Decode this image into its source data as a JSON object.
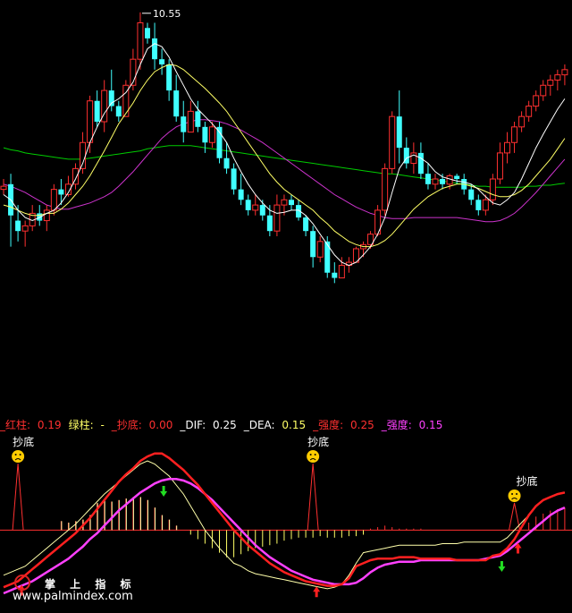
{
  "chart_data": [
    {
      "type": "candlestick",
      "title": "",
      "peak_label": "10.55",
      "x": [
        1,
        2,
        3,
        4,
        5,
        6,
        7,
        8,
        9,
        10,
        11,
        12,
        13,
        14,
        15,
        16,
        17,
        18,
        19,
        20,
        21,
        22,
        23,
        24,
        25,
        26,
        27,
        28,
        29,
        30,
        31,
        32,
        33,
        34,
        35,
        36,
        37,
        38,
        39,
        40,
        41,
        42,
        43,
        44,
        45,
        46,
        47,
        48,
        49,
        50,
        51,
        52,
        53,
        54,
        55,
        56,
        57,
        58,
        59,
        60,
        61,
        62,
        63,
        64,
        65,
        66,
        67,
        68,
        69,
        70,
        71,
        72,
        73,
        74,
        75,
        76,
        77,
        78,
        79
      ],
      "ohlc": [
        [
          8.85,
          8.95,
          8.8,
          8.88
        ],
        [
          8.9,
          9.0,
          8.3,
          8.6
        ],
        [
          8.55,
          8.7,
          8.35,
          8.45
        ],
        [
          8.45,
          8.55,
          8.3,
          8.5
        ],
        [
          8.5,
          8.7,
          8.45,
          8.62
        ],
        [
          8.62,
          8.7,
          8.5,
          8.55
        ],
        [
          8.55,
          8.7,
          8.45,
          8.65
        ],
        [
          8.65,
          8.9,
          8.6,
          8.85
        ],
        [
          8.85,
          8.95,
          8.7,
          8.8
        ],
        [
          8.8,
          8.98,
          8.78,
          8.9
        ],
        [
          8.9,
          9.1,
          8.85,
          9.05
        ],
        [
          9.05,
          9.4,
          9.0,
          9.3
        ],
        [
          9.3,
          9.75,
          9.2,
          9.7
        ],
        [
          9.7,
          9.8,
          9.45,
          9.5
        ],
        [
          9.5,
          9.9,
          9.4,
          9.8
        ],
        [
          9.8,
          10.0,
          9.6,
          9.65
        ],
        [
          9.65,
          9.7,
          9.5,
          9.55
        ],
        [
          9.55,
          9.9,
          9.55,
          9.85
        ],
        [
          9.85,
          10.2,
          9.8,
          10.1
        ],
        [
          10.1,
          10.55,
          10.0,
          10.45
        ],
        [
          10.4,
          10.45,
          10.25,
          10.3
        ],
        [
          10.3,
          10.45,
          10.0,
          10.1
        ],
        [
          10.1,
          10.2,
          9.95,
          10.05
        ],
        [
          10.05,
          10.1,
          9.7,
          9.8
        ],
        [
          9.8,
          9.95,
          9.5,
          9.55
        ],
        [
          9.55,
          9.7,
          9.3,
          9.4
        ],
        [
          9.4,
          9.7,
          9.4,
          9.6
        ],
        [
          9.6,
          9.7,
          9.4,
          9.45
        ],
        [
          9.45,
          9.5,
          9.2,
          9.3
        ],
        [
          9.3,
          9.5,
          9.25,
          9.45
        ],
        [
          9.45,
          9.5,
          9.1,
          9.15
        ],
        [
          9.15,
          9.3,
          9.0,
          9.05
        ],
        [
          9.05,
          9.1,
          8.8,
          8.85
        ],
        [
          8.85,
          9.0,
          8.7,
          8.75
        ],
        [
          8.75,
          8.8,
          8.6,
          8.65
        ],
        [
          8.65,
          8.8,
          8.6,
          8.7
        ],
        [
          8.7,
          8.75,
          8.55,
          8.6
        ],
        [
          8.6,
          8.7,
          8.4,
          8.45
        ],
        [
          8.45,
          8.8,
          8.4,
          8.7
        ],
        [
          8.7,
          8.8,
          8.6,
          8.75
        ],
        [
          8.75,
          8.8,
          8.65,
          8.7
        ],
        [
          8.7,
          8.75,
          8.55,
          8.58
        ],
        [
          8.58,
          8.6,
          8.4,
          8.45
        ],
        [
          8.45,
          8.5,
          8.1,
          8.2
        ],
        [
          8.2,
          8.4,
          8.15,
          8.35
        ],
        [
          8.35,
          8.4,
          8.0,
          8.05
        ],
        [
          8.05,
          8.15,
          7.95,
          8.0
        ],
        [
          8.0,
          8.2,
          8.0,
          8.12
        ],
        [
          8.12,
          8.2,
          8.05,
          8.15
        ],
        [
          8.15,
          8.3,
          8.15,
          8.28
        ],
        [
          8.28,
          8.35,
          8.2,
          8.32
        ],
        [
          8.32,
          8.45,
          8.28,
          8.42
        ],
        [
          8.42,
          8.7,
          8.4,
          8.65
        ],
        [
          8.65,
          9.1,
          8.6,
          9.05
        ],
        [
          9.05,
          9.6,
          9.0,
          9.55
        ],
        [
          9.55,
          9.8,
          9.1,
          9.25
        ],
        [
          9.25,
          9.35,
          9.05,
          9.1
        ],
        [
          9.1,
          9.3,
          9.0,
          9.2
        ],
        [
          9.2,
          9.3,
          8.95,
          9.0
        ],
        [
          9.0,
          9.1,
          8.85,
          8.9
        ],
        [
          8.9,
          9.0,
          8.85,
          8.95
        ],
        [
          8.95,
          9.0,
          8.85,
          8.9
        ],
        [
          8.9,
          9.0,
          8.85,
          8.98
        ],
        [
          8.98,
          9.0,
          8.9,
          8.95
        ],
        [
          8.95,
          9.0,
          8.8,
          8.85
        ],
        [
          8.85,
          8.9,
          8.7,
          8.75
        ],
        [
          8.75,
          8.8,
          8.6,
          8.65
        ],
        [
          8.65,
          8.8,
          8.6,
          8.75
        ],
        [
          8.75,
          9.0,
          8.7,
          8.95
        ],
        [
          8.95,
          9.3,
          8.9,
          9.2
        ],
        [
          9.2,
          9.4,
          9.1,
          9.3
        ],
        [
          9.3,
          9.5,
          9.2,
          9.45
        ],
        [
          9.45,
          9.6,
          9.4,
          9.55
        ],
        [
          9.55,
          9.7,
          9.5,
          9.65
        ],
        [
          9.65,
          9.8,
          9.6,
          9.75
        ],
        [
          9.75,
          9.9,
          9.7,
          9.85
        ],
        [
          9.85,
          9.95,
          9.75,
          9.9
        ],
        [
          9.9,
          10.0,
          9.8,
          9.95
        ],
        [
          9.95,
          10.05,
          9.85,
          10.0
        ]
      ],
      "ma_short": [
        8.8,
        8.75,
        8.65,
        8.58,
        8.55,
        8.58,
        8.62,
        8.65,
        8.72,
        8.82,
        8.95,
        9.1,
        9.3,
        9.45,
        9.58,
        9.68,
        9.72,
        9.78,
        9.88,
        10.05,
        10.2,
        10.25,
        10.22,
        10.12,
        9.98,
        9.85,
        9.72,
        9.62,
        9.55,
        9.48,
        9.4,
        9.3,
        9.15,
        9.02,
        8.9,
        8.8,
        8.72,
        8.65,
        8.62,
        8.63,
        8.65,
        8.65,
        8.6,
        8.52,
        8.42,
        8.32,
        8.22,
        8.15,
        8.12,
        8.15,
        8.22,
        8.3,
        8.42,
        8.58,
        8.82,
        9.05,
        9.15,
        9.18,
        9.15,
        9.1,
        9.02,
        8.97,
        8.95,
        8.93,
        8.92,
        8.9,
        8.85,
        8.78,
        8.72,
        8.7,
        8.75,
        8.82,
        8.95,
        9.1,
        9.25,
        9.38,
        9.5,
        9.62,
        9.72
      ],
      "ma_medium": [
        8.7,
        8.68,
        8.65,
        8.62,
        8.6,
        8.6,
        8.62,
        8.62,
        8.66,
        8.72,
        8.8,
        8.88,
        8.98,
        9.1,
        9.22,
        9.35,
        9.48,
        9.58,
        9.68,
        9.8,
        9.9,
        9.98,
        10.02,
        10.05,
        10.04,
        10.0,
        9.94,
        9.88,
        9.82,
        9.75,
        9.68,
        9.6,
        9.5,
        9.4,
        9.3,
        9.2,
        9.1,
        9.0,
        8.92,
        8.85,
        8.8,
        8.75,
        8.7,
        8.65,
        8.58,
        8.52,
        8.45,
        8.4,
        8.35,
        8.32,
        8.3,
        8.3,
        8.32,
        8.36,
        8.42,
        8.5,
        8.58,
        8.66,
        8.72,
        8.78,
        8.82,
        8.86,
        8.88,
        8.9,
        8.9,
        8.88,
        8.86,
        8.83,
        8.8,
        8.78,
        8.78,
        8.8,
        8.84,
        8.9,
        8.98,
        9.06,
        9.14,
        9.24,
        9.34
      ],
      "ma_long_magenta": [
        8.9,
        8.88,
        8.85,
        8.82,
        8.78,
        8.74,
        8.7,
        8.68,
        8.66,
        8.66,
        8.68,
        8.7,
        8.72,
        8.75,
        8.78,
        8.82,
        8.88,
        8.95,
        9.02,
        9.1,
        9.18,
        9.26,
        9.34,
        9.4,
        9.45,
        9.48,
        9.5,
        9.52,
        9.52,
        9.51,
        9.5,
        9.48,
        9.45,
        9.42,
        9.38,
        9.34,
        9.3,
        9.25,
        9.2,
        9.15,
        9.1,
        9.05,
        9.0,
        8.95,
        8.9,
        8.85,
        8.8,
        8.76,
        8.72,
        8.68,
        8.65,
        8.62,
        8.6,
        8.58,
        8.57,
        8.57,
        8.57,
        8.58,
        8.58,
        8.58,
        8.58,
        8.58,
        8.58,
        8.58,
        8.57,
        8.56,
        8.55,
        8.54,
        8.54,
        8.55,
        8.58,
        8.62,
        8.68,
        8.75,
        8.82,
        8.9,
        8.98,
        9.06,
        9.14
      ],
      "ma_long_green": [
        9.25,
        9.23,
        9.22,
        9.2,
        9.19,
        9.18,
        9.17,
        9.16,
        9.15,
        9.14,
        9.14,
        9.14,
        9.15,
        9.16,
        9.17,
        9.18,
        9.19,
        9.2,
        9.21,
        9.22,
        9.24,
        9.25,
        9.26,
        9.27,
        9.27,
        9.27,
        9.27,
        9.26,
        9.25,
        9.24,
        9.23,
        9.22,
        9.21,
        9.2,
        9.19,
        9.18,
        9.17,
        9.16,
        9.15,
        9.14,
        9.13,
        9.12,
        9.11,
        9.1,
        9.09,
        9.08,
        9.07,
        9.06,
        9.05,
        9.04,
        9.03,
        9.02,
        9.01,
        9.0,
        9.0,
        8.99,
        8.98,
        8.97,
        8.96,
        8.95,
        8.94,
        8.93,
        8.92,
        8.91,
        8.9,
        8.89,
        8.88,
        8.88,
        8.87,
        8.87,
        8.87,
        8.87,
        8.87,
        8.88,
        8.88,
        8.89,
        8.89,
        8.9,
        8.91
      ],
      "ylim": [
        7.3,
        10.6
      ]
    },
    {
      "type": "bar",
      "title": "",
      "legend": [
        {
          "name": "_红柱",
          "value": "0.19",
          "color": "#ff3030"
        },
        {
          "name": "绿柱",
          "value": "-",
          "color": "#ffff66"
        },
        {
          "name": "_抄底",
          "value": "0.00",
          "color": "#ff3030"
        },
        {
          "name": "_DIF",
          "value": "0.25",
          "color": "#ffffff"
        },
        {
          "name": "_DEA",
          "value": "0.15",
          "color": "#ffff66"
        },
        {
          "name": "_强度",
          "value": "0.25",
          "color": "#ff3030"
        },
        {
          "name": "_强度",
          "value": "0.15",
          "color": "#ff40ff"
        }
      ],
      "bars": [
        0.0,
        0.0,
        0.0,
        0.0,
        0.0,
        0.0,
        0.0,
        0.0,
        0.06,
        0.05,
        0.06,
        0.07,
        0.1,
        0.18,
        0.2,
        0.19,
        0.2,
        0.21,
        0.22,
        0.22,
        0.2,
        0.15,
        0.1,
        0.07,
        0.03,
        0.0,
        -0.03,
        -0.06,
        -0.09,
        -0.12,
        -0.15,
        -0.18,
        -0.18,
        -0.16,
        -0.14,
        -0.12,
        -0.11,
        -0.1,
        -0.09,
        -0.07,
        -0.06,
        -0.05,
        -0.05,
        -0.05,
        -0.04,
        -0.05,
        -0.05,
        -0.05,
        -0.04,
        -0.04,
        -0.03,
        0.01,
        0.02,
        0.03,
        0.02,
        0.01,
        0.01,
        0.01,
        0.01,
        0.0,
        0.0,
        0.0,
        0.0,
        0.0,
        0.0,
        0.0,
        0.0,
        0.0,
        0.0,
        0.0,
        0.0,
        0.0,
        0.0,
        0.05,
        0.09,
        0.11,
        0.13,
        0.14,
        0.15
      ],
      "dif": [
        -0.3,
        -0.28,
        -0.26,
        -0.24,
        -0.2,
        -0.16,
        -0.12,
        -0.08,
        -0.04,
        0.0,
        0.04,
        0.09,
        0.14,
        0.19,
        0.24,
        0.28,
        0.32,
        0.36,
        0.4,
        0.44,
        0.46,
        0.44,
        0.4,
        0.36,
        0.3,
        0.24,
        0.16,
        0.08,
        0.0,
        -0.06,
        -0.12,
        -0.17,
        -0.22,
        -0.24,
        -0.27,
        -0.29,
        -0.3,
        -0.31,
        -0.32,
        -0.33,
        -0.34,
        -0.35,
        -0.36,
        -0.37,
        -0.38,
        -0.39,
        -0.38,
        -0.36,
        -0.3,
        -0.22,
        -0.15,
        -0.14,
        -0.13,
        -0.12,
        -0.11,
        -0.1,
        -0.1,
        -0.1,
        -0.1,
        -0.1,
        -0.1,
        -0.09,
        -0.09,
        -0.09,
        -0.08,
        -0.08,
        -0.08,
        -0.08,
        -0.08,
        -0.08,
        -0.05,
        0.0,
        0.05,
        0.1,
        0.16,
        0.2,
        0.22,
        0.24,
        0.25
      ],
      "dea": [
        -0.35,
        -0.33,
        -0.31,
        -0.29,
        -0.27,
        -0.24,
        -0.21,
        -0.18,
        -0.15,
        -0.11,
        -0.07,
        -0.03,
        0.02,
        0.06,
        0.1,
        0.14,
        0.18,
        0.21,
        0.25,
        0.29,
        0.32,
        0.35,
        0.36,
        0.36,
        0.35,
        0.33,
        0.3,
        0.26,
        0.21,
        0.16,
        0.11,
        0.06,
        0.0,
        -0.04,
        -0.08,
        -0.12,
        -0.16,
        -0.19,
        -0.22,
        -0.25,
        -0.28,
        -0.3,
        -0.32,
        -0.33,
        -0.34,
        -0.35,
        -0.36,
        -0.36,
        -0.36,
        -0.36,
        -0.35,
        -0.34,
        -0.33,
        -0.31,
        -0.29,
        -0.27,
        -0.24,
        -0.2,
        -0.16,
        -0.14,
        -0.13,
        -0.12,
        -0.12,
        -0.11,
        -0.11,
        -0.1,
        -0.1,
        -0.09,
        -0.09,
        -0.09,
        -0.08,
        -0.07,
        -0.05,
        -0.02,
        0.01,
        0.05,
        0.09,
        0.12,
        0.15
      ],
      "strength_red": [
        -0.38,
        -0.36,
        -0.34,
        -0.3,
        -0.26,
        -0.22,
        -0.18,
        -0.14,
        -0.1,
        -0.06,
        -0.02,
        0.03,
        0.08,
        0.14,
        0.2,
        0.26,
        0.32,
        0.37,
        0.41,
        0.46,
        0.49,
        0.51,
        0.51,
        0.48,
        0.44,
        0.4,
        0.35,
        0.3,
        0.24,
        0.18,
        0.12,
        0.06,
        0.0,
        -0.05,
        -0.1,
        -0.14,
        -0.18,
        -0.22,
        -0.25,
        -0.28,
        -0.3,
        -0.32,
        -0.34,
        -0.35,
        -0.36,
        -0.37,
        -0.37,
        -0.36,
        -0.32,
        -0.24,
        -0.22,
        -0.2,
        -0.19,
        -0.19,
        -0.19,
        -0.18,
        -0.18,
        -0.18,
        -0.19,
        -0.19,
        -0.19,
        -0.19,
        -0.19,
        -0.2,
        -0.2,
        -0.2,
        -0.2,
        -0.2,
        -0.17,
        -0.16,
        -0.12,
        -0.06,
        0.02,
        0.1,
        0.16,
        0.2,
        0.22,
        0.24,
        0.25
      ],
      "strength_magenta": [
        -0.42,
        -0.4,
        -0.38,
        -0.36,
        -0.34,
        -0.31,
        -0.28,
        -0.25,
        -0.22,
        -0.19,
        -0.15,
        -0.11,
        -0.06,
        -0.02,
        0.03,
        0.08,
        0.13,
        0.17,
        0.21,
        0.25,
        0.28,
        0.31,
        0.33,
        0.34,
        0.34,
        0.33,
        0.31,
        0.28,
        0.24,
        0.2,
        0.15,
        0.1,
        0.05,
        0.0,
        -0.05,
        -0.1,
        -0.14,
        -0.18,
        -0.21,
        -0.24,
        -0.27,
        -0.29,
        -0.31,
        -0.33,
        -0.34,
        -0.35,
        -0.36,
        -0.36,
        -0.36,
        -0.35,
        -0.32,
        -0.28,
        -0.25,
        -0.23,
        -0.22,
        -0.21,
        -0.21,
        -0.21,
        -0.2,
        -0.2,
        -0.2,
        -0.2,
        -0.2,
        -0.2,
        -0.2,
        -0.2,
        -0.2,
        -0.19,
        -0.18,
        -0.17,
        -0.14,
        -0.1,
        -0.06,
        -0.02,
        0.02,
        0.06,
        0.1,
        0.13,
        0.15
      ],
      "bottom_signals": [
        {
          "x": 2,
          "label": "抄底"
        },
        {
          "x": 43,
          "label": "抄底"
        },
        {
          "x": 71,
          "label": "抄底"
        }
      ],
      "up_arrows": [
        2,
        43,
        71
      ],
      "down_arrows": [
        22,
        69
      ],
      "ylim": [
        -0.45,
        0.55
      ]
    }
  ],
  "watermark": {
    "cn": "掌 上 指 标",
    "url": "www.palmindex.com"
  }
}
